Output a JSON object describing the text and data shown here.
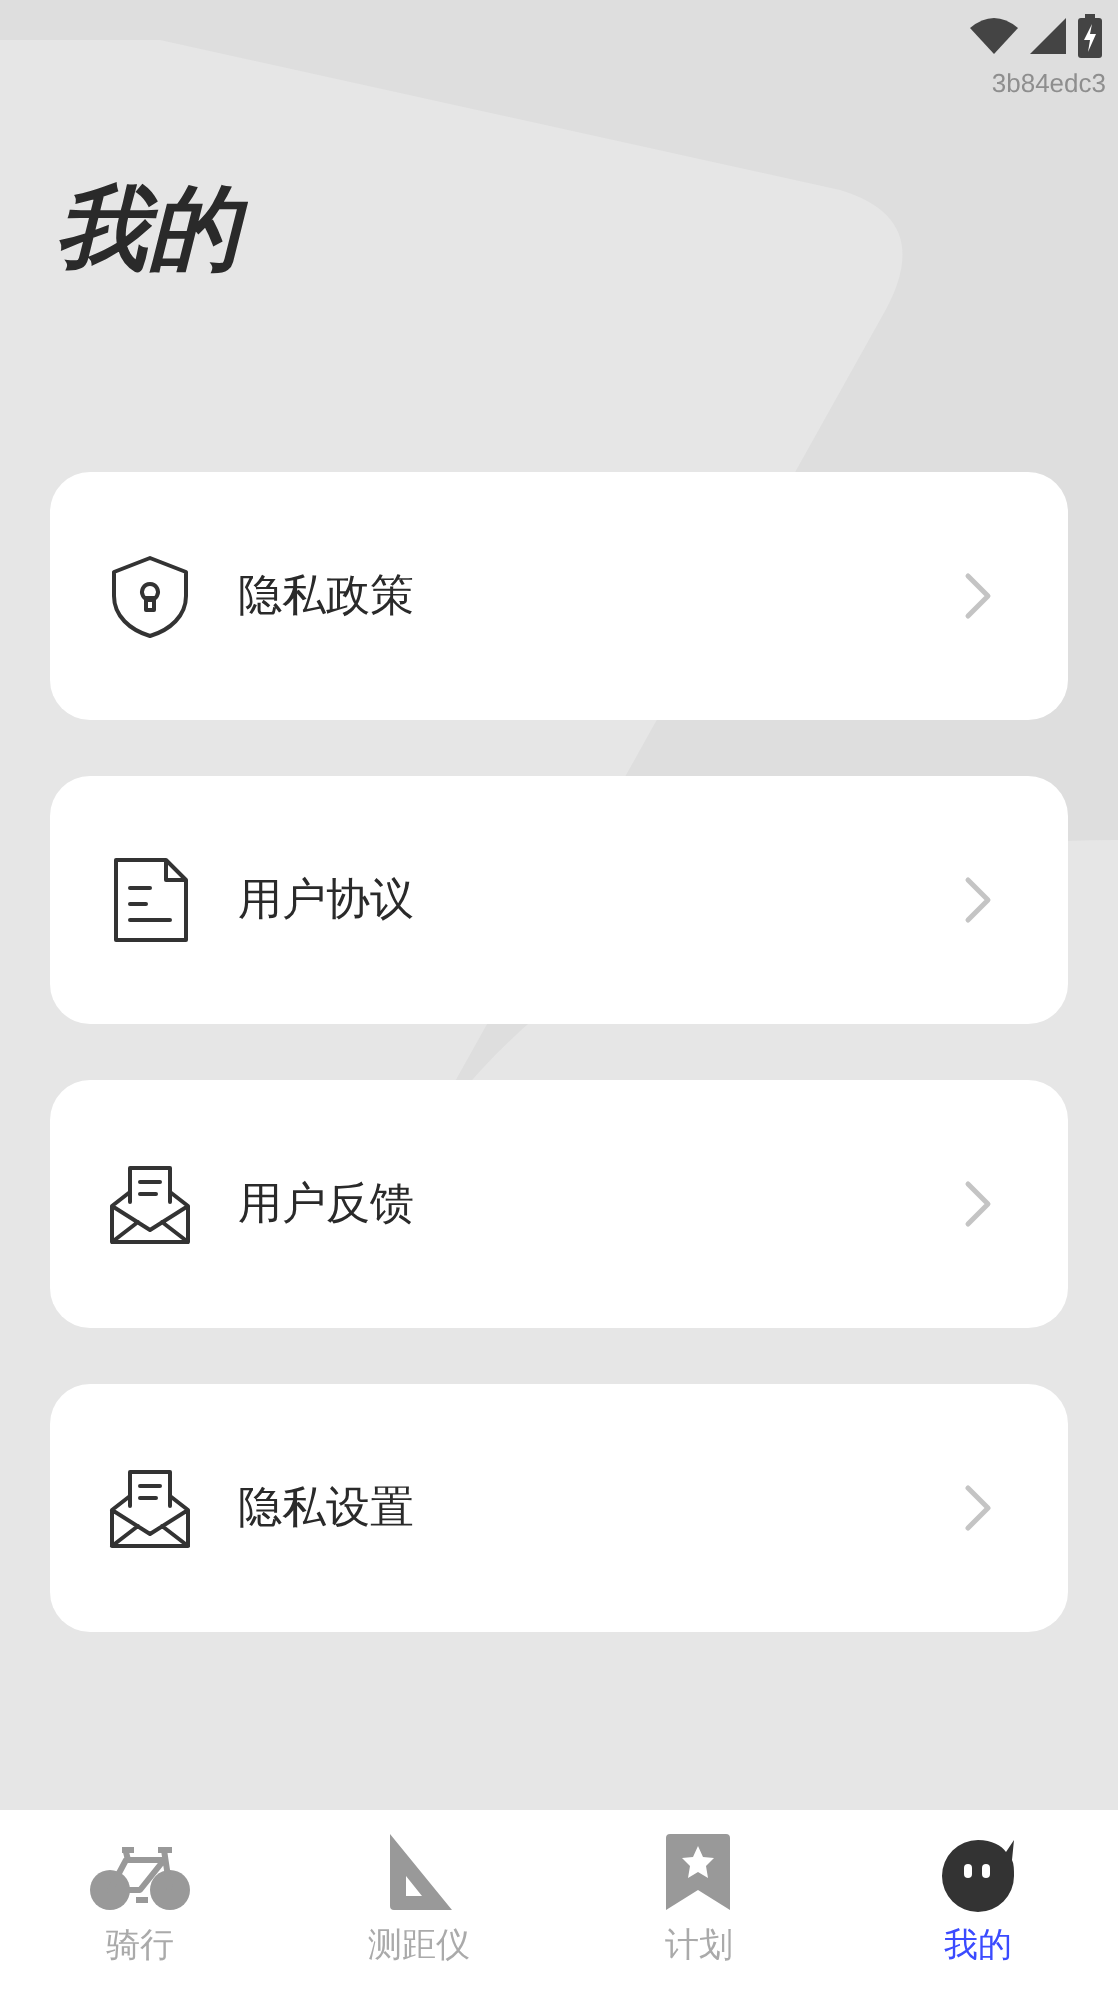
{
  "status_bar": {
    "version": "3b84edc3"
  },
  "title": "我的",
  "menu": [
    {
      "label": "隐私政策",
      "kind": "shield"
    },
    {
      "label": "用户协议",
      "kind": "document"
    },
    {
      "label": "用户反馈",
      "kind": "mail"
    },
    {
      "label": "隐私设置",
      "kind": "mail"
    }
  ],
  "tab_bar": [
    {
      "label": "骑行",
      "kind": "bike",
      "selected": false
    },
    {
      "label": "测距仪",
      "kind": "ruler",
      "selected": false
    },
    {
      "label": "计划",
      "kind": "bookmark",
      "selected": false
    },
    {
      "label": "我的",
      "kind": "avatar",
      "selected": true
    }
  ]
}
